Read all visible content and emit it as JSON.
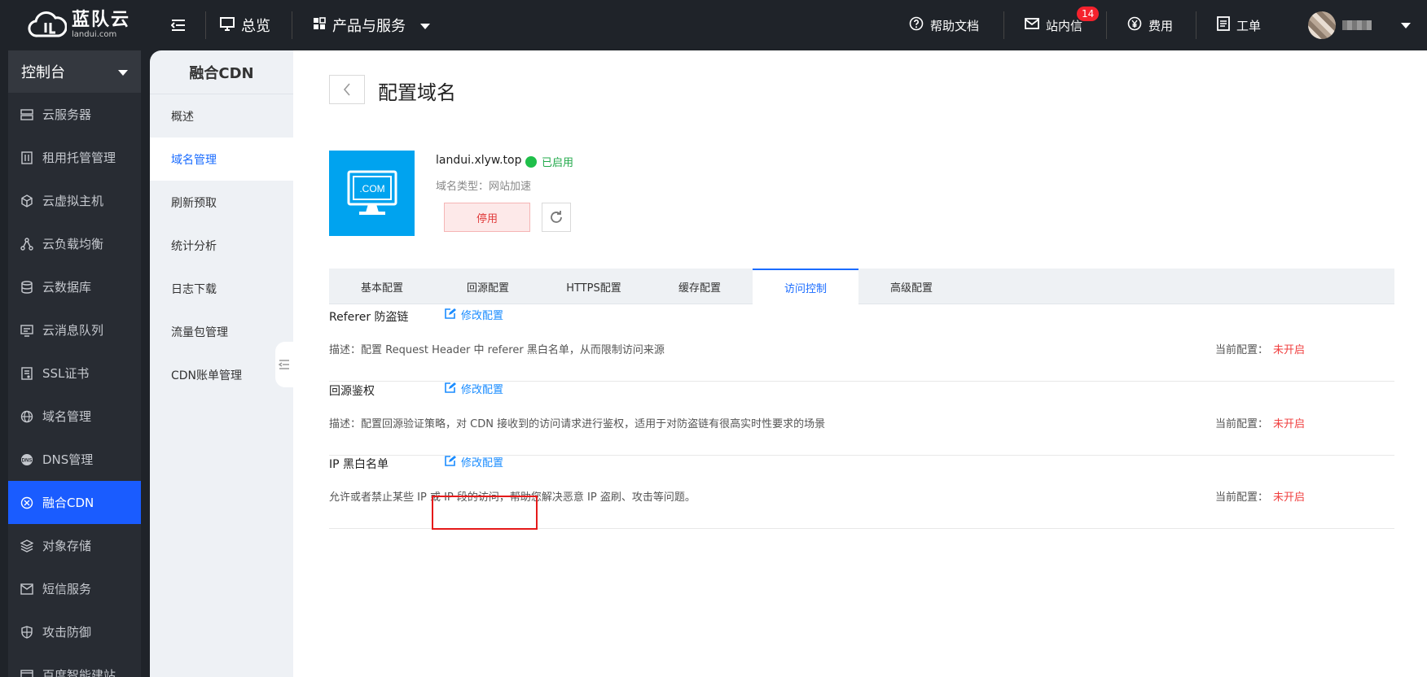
{
  "brand": {
    "name_cn": "蓝队云",
    "name_en": "landui.com"
  },
  "topbar": {
    "overview": "总览",
    "products": "产品与服务",
    "help": "帮助文档",
    "messages": "站内信",
    "message_count": "14",
    "fees": "费用",
    "tickets": "工单"
  },
  "sidebar": {
    "header": "控制台",
    "items": [
      {
        "label": "云服务器",
        "icon": "server-icon"
      },
      {
        "label": "租用托管管理",
        "icon": "hosting-icon"
      },
      {
        "label": "云虚拟主机",
        "icon": "cube-icon"
      },
      {
        "label": "云负载均衡",
        "icon": "balance-icon"
      },
      {
        "label": "云数据库",
        "icon": "database-icon"
      },
      {
        "label": "云消息队列",
        "icon": "message-queue-icon"
      },
      {
        "label": "SSL证书",
        "icon": "certificate-icon"
      },
      {
        "label": "域名管理",
        "icon": "globe-icon"
      },
      {
        "label": "DNS管理",
        "icon": "dns-icon"
      },
      {
        "label": "融合CDN",
        "icon": "cdn-icon",
        "active": true
      },
      {
        "label": "对象存储",
        "icon": "storage-icon"
      },
      {
        "label": "短信服务",
        "icon": "sms-icon"
      },
      {
        "label": "攻击防御",
        "icon": "shield-icon"
      },
      {
        "label": "百度智能建站",
        "icon": "site-builder-icon"
      }
    ]
  },
  "submenu": {
    "title": "融合CDN",
    "items": [
      "概述",
      "域名管理",
      "刷新预取",
      "统计分析",
      "日志下载",
      "流量包管理",
      "CDN账单管理"
    ],
    "active_index": 1
  },
  "page": {
    "title": "配置域名",
    "domain": "landui.xlyw.top",
    "status": "已启用",
    "domain_type_label": "域名类型：",
    "domain_type": "网站加速",
    "thumb_text": ".COM",
    "stop_button": "停用"
  },
  "tabs": [
    "基本配置",
    "回源配置",
    "HTTPS配置",
    "缓存配置",
    "访问控制",
    "高级配置"
  ],
  "active_tab": 4,
  "sections": [
    {
      "name": "Referer 防盗链",
      "edit_label": "修改配置",
      "description": "描述：配置 Request Header 中 referer 黑白名单，从而限制访问来源",
      "current_label": "当前配置：",
      "current_value": "未开启"
    },
    {
      "name": "回源鉴权",
      "edit_label": "修改配置",
      "description": "描述：配置回源验证策略，对 CDN 接收到的访问请求进行鉴权，适用于对防盗链有很高实时性要求的场景",
      "current_label": "当前配置：",
      "current_value": "未开启"
    },
    {
      "name": "IP 黑白名单",
      "edit_label": "修改配置",
      "description": "允许或者禁止某些 IP 或 IP 段的访问，帮助您解决恶意 IP 盗刷、攻击等问题。",
      "current_label": "当前配置：",
      "current_value": "未开启"
    }
  ],
  "colors": {
    "accent": "#1a6cff",
    "sidebar_active": "#1a5cff",
    "status_green": "#1fbf4a",
    "off_red": "#f04040"
  }
}
